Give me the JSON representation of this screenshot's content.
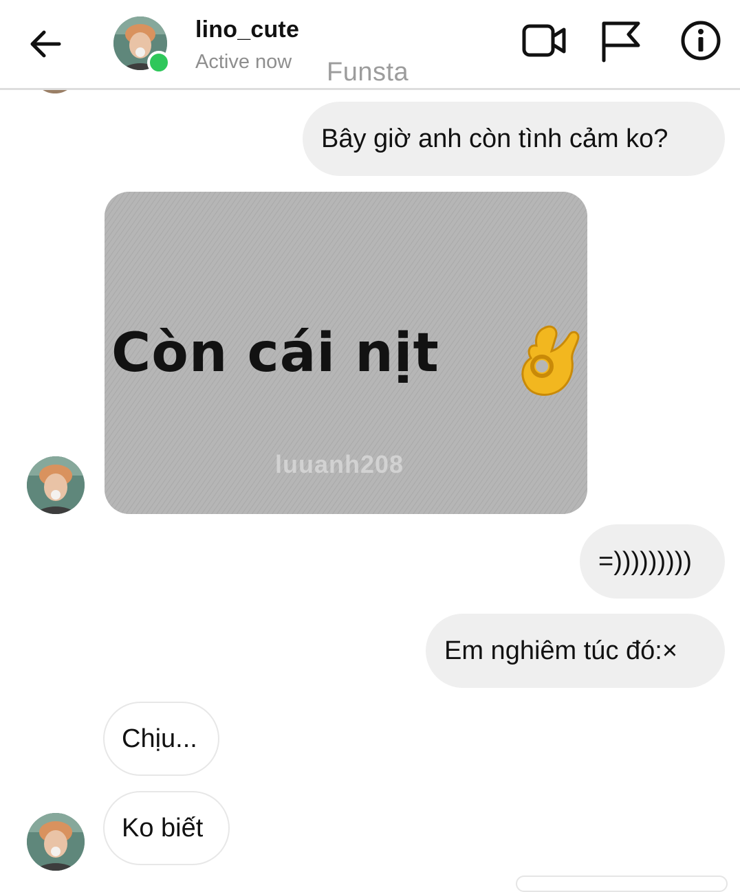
{
  "header": {
    "username": "lino_cute",
    "status": "Active now",
    "account_label": "Funsta",
    "online_color": "#2ec75a",
    "icons": [
      "back-arrow-icon",
      "video-camera-icon",
      "flag-icon",
      "info-icon"
    ]
  },
  "messages": [
    {
      "direction": "outgoing",
      "type": "text",
      "text": "Bây giờ anh còn tình cảm ko?"
    },
    {
      "direction": "incoming",
      "type": "sticker",
      "caption": "Còn cái nịt",
      "emoji": "ok-hand-emoji",
      "watermark": "luuanh208"
    },
    {
      "direction": "outgoing",
      "type": "text",
      "text": "=)))))))))"
    },
    {
      "direction": "outgoing",
      "type": "text",
      "text": "Em nghiêm túc đó:×"
    },
    {
      "direction": "incoming",
      "type": "text",
      "text": "Chịu..."
    },
    {
      "direction": "incoming",
      "type": "text",
      "text": "Ko biết"
    }
  ],
  "colors": {
    "outgoing_bubble": "#efefef",
    "incoming_border": "#e7e7e7",
    "secondary_text": "#8e8e8e"
  }
}
